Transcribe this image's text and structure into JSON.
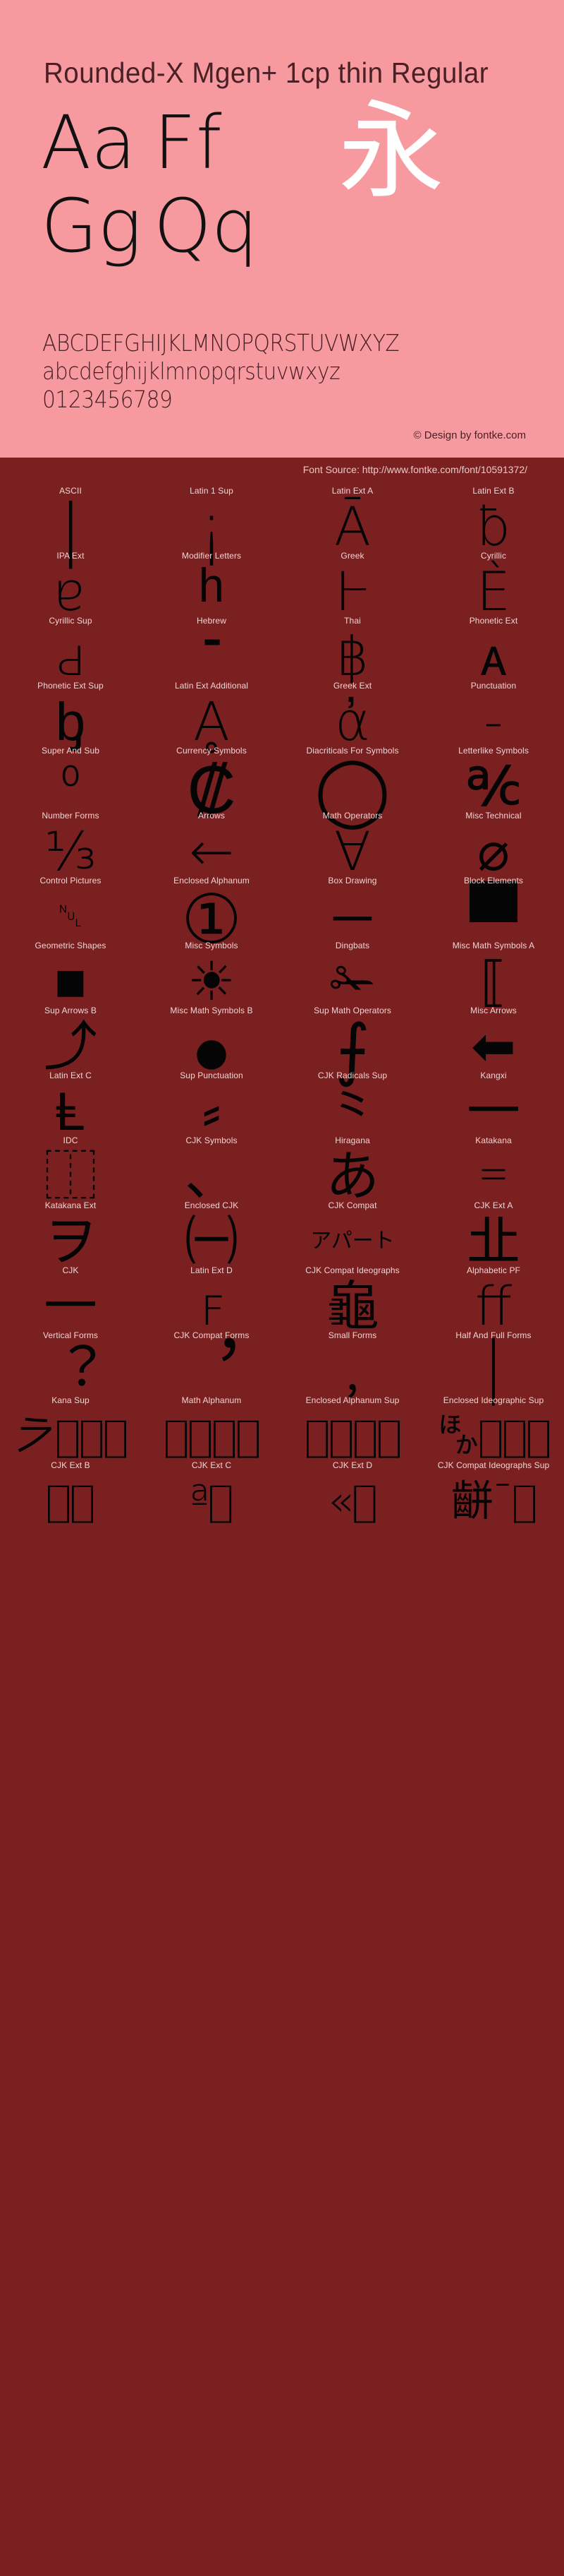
{
  "header": {
    "font_title": "Rounded-X Mgen+ 1cp thin Regular",
    "sample_pairs": [
      {
        "upper": "Aa",
        "second": "Ff"
      },
      {
        "upper": "Gg",
        "second": "Qq"
      }
    ],
    "cjk_sample": "永",
    "alphabet_upper": "ABCDEFGHIJKLMNOPQRSTUVWXYZ",
    "alphabet_lower": "abcdefghijklmnopqrstuvwxyz",
    "digits": "0123456789",
    "copyright": "© Design by fontke.com",
    "background_color": "#f79aa0",
    "text_color": "#4a2025",
    "cjk_color": "#ffffff"
  },
  "source": {
    "label": "Font Source: http://www.fontke.com/font/10591372/"
  },
  "body": {
    "background_color": "#7b2020",
    "label_color": "#f0d4d4",
    "glyph_color": "#050505"
  },
  "blocks": [
    {
      "label": "ASCII",
      "glyph": "|",
      "cls": "tall"
    },
    {
      "label": "Latin 1 Sup",
      "glyph": "¡",
      "cls": "tall"
    },
    {
      "label": "Latin Ext A",
      "glyph": "Ā",
      "cls": ""
    },
    {
      "label": "Latin Ext B",
      "glyph": "ƀ",
      "cls": ""
    },
    {
      "label": "IPA Ext",
      "glyph": "ɐ",
      "cls": ""
    },
    {
      "label": "Modifier Letters",
      "glyph": "ʰ",
      "cls": "tall"
    },
    {
      "label": "Greek",
      "glyph": "Ͱ",
      "cls": ""
    },
    {
      "label": "Cyrillic",
      "glyph": "Ѐ",
      "cls": ""
    },
    {
      "label": "Cyrillic Sup",
      "glyph": "ԁ",
      "cls": ""
    },
    {
      "label": "Hebrew",
      "glyph": "־",
      "cls": ""
    },
    {
      "label": "Thai",
      "glyph": "฿",
      "cls": ""
    },
    {
      "label": "Phonetic Ext",
      "glyph": "ᴀ",
      "cls": ""
    },
    {
      "label": "Phonetic Ext Sup",
      "glyph": "ᶀ",
      "cls": ""
    },
    {
      "label": "Latin Ext Additional",
      "glyph": "Ḁ",
      "cls": ""
    },
    {
      "label": "Greek Ext",
      "glyph": "ἀ",
      "cls": ""
    },
    {
      "label": "Punctuation",
      "glyph": "‐",
      "cls": ""
    },
    {
      "label": "Super And Sub",
      "glyph": "⁰",
      "cls": ""
    },
    {
      "label": "Currency Symbols",
      "glyph": "₡",
      "cls": "tall"
    },
    {
      "label": "Diacriticals For Symbols",
      "glyph": "◯",
      "cls": "tall"
    },
    {
      "label": "Letterlike Symbols",
      "glyph": "℀",
      "cls": ""
    },
    {
      "label": "Number Forms",
      "glyph": "⅓",
      "cls": ""
    },
    {
      "label": "Arrows",
      "glyph": "←",
      "cls": ""
    },
    {
      "label": "Math Operators",
      "glyph": "∀",
      "cls": ""
    },
    {
      "label": "Misc Technical",
      "glyph": "⌀",
      "cls": ""
    },
    {
      "label": "Control Pictures",
      "glyph": "␀",
      "cls": "sm"
    },
    {
      "label": "Enclosed Alphanum",
      "glyph": "①",
      "cls": "tall"
    },
    {
      "label": "Box Drawing",
      "glyph": "─",
      "cls": ""
    },
    {
      "label": "Block Elements",
      "glyph": "▀",
      "cls": "tall"
    },
    {
      "label": "Geometric Shapes",
      "glyph": "■",
      "cls": ""
    },
    {
      "label": "Misc Symbols",
      "glyph": "☀",
      "cls": ""
    },
    {
      "label": "Dingbats",
      "glyph": "✁",
      "cls": ""
    },
    {
      "label": "Misc Math Symbols A",
      "glyph": "⟦",
      "cls": ""
    },
    {
      "label": "Sup Arrows B",
      "glyph": "⤴",
      "cls": ""
    },
    {
      "label": "Misc Math Symbols B",
      "glyph": "⦁",
      "cls": "tall"
    },
    {
      "label": "Sup Math Operators",
      "glyph": "⨍",
      "cls": "tall"
    },
    {
      "label": "Misc Arrows",
      "glyph": "⬅",
      "cls": ""
    },
    {
      "label": "Latin Ext C",
      "glyph": "Ⱡ",
      "cls": ""
    },
    {
      "label": "Sup Punctuation",
      "glyph": "⸗",
      "cls": ""
    },
    {
      "label": "CJK Radicals Sup",
      "glyph": "⺀",
      "cls": ""
    },
    {
      "label": "Kangxi",
      "glyph": "一",
      "cls": ""
    },
    {
      "label": "IDC",
      "glyph": "⿰",
      "cls": ""
    },
    {
      "label": "CJK Symbols",
      "glyph": "、",
      "cls": ""
    },
    {
      "label": "Hiragana",
      "glyph": "あ",
      "cls": ""
    },
    {
      "label": "Katakana",
      "glyph": "゠",
      "cls": ""
    },
    {
      "label": "Katakana Ext",
      "glyph": "ヲ",
      "cls": ""
    },
    {
      "label": "Enclosed CJK",
      "glyph": "㈠",
      "cls": ""
    },
    {
      "label": "CJK Compat",
      "glyph": "アパート",
      "cls": "xs"
    },
    {
      "label": "CJK Ext A",
      "glyph": "㐀",
      "cls": ""
    },
    {
      "label": "CJK",
      "glyph": "一",
      "cls": ""
    },
    {
      "label": "Latin Ext D",
      "glyph": "ꜰ",
      "cls": ""
    },
    {
      "label": "CJK Compat Ideographs",
      "glyph": "龜",
      "cls": ""
    },
    {
      "label": "Alphabetic PF",
      "glyph": "ﬀ",
      "cls": ""
    },
    {
      "label": "Vertical Forms",
      "glyph": "︖",
      "cls": ""
    },
    {
      "label": "CJK Compat Forms",
      "glyph": "︐",
      "cls": "tall"
    },
    {
      "label": "Small Forms",
      "glyph": "﹐",
      "cls": ""
    },
    {
      "label": "Half And Full Forms",
      "glyph": "｜",
      "cls": "tall"
    },
    {
      "label": "Kana Sup",
      "glyph": "𛀀􏿽􏿽􏿽",
      "cls": "wide-run"
    },
    {
      "label": "Math Alphanum",
      "glyph": "𝐀􏿽􏿽􏿽",
      "cls": "wide-run"
    },
    {
      "label": "Enclosed Alphanum Sup",
      "glyph": "🄀􏿽􏿽􏿽",
      "cls": "wide-run"
    },
    {
      "label": "Enclosed Ideographic Sup",
      "glyph": "🈀􏿽􏿽􏿽",
      "cls": "wide-run"
    },
    {
      "label": "CJK Ext B",
      "glyph": "𠀀􏿽􏿽",
      "cls": "wide-run"
    },
    {
      "label": "CJK Ext C",
      "glyph": "𪜀ª􏿽",
      "cls": "wide-run"
    },
    {
      "label": "CJK Ext D",
      "glyph": "𫝀«􏿽",
      "cls": "wide-run"
    },
    {
      "label": "CJK Compat Ideographs Sup",
      "glyph": "𪘀¯􏿽",
      "cls": "wide-run"
    }
  ]
}
